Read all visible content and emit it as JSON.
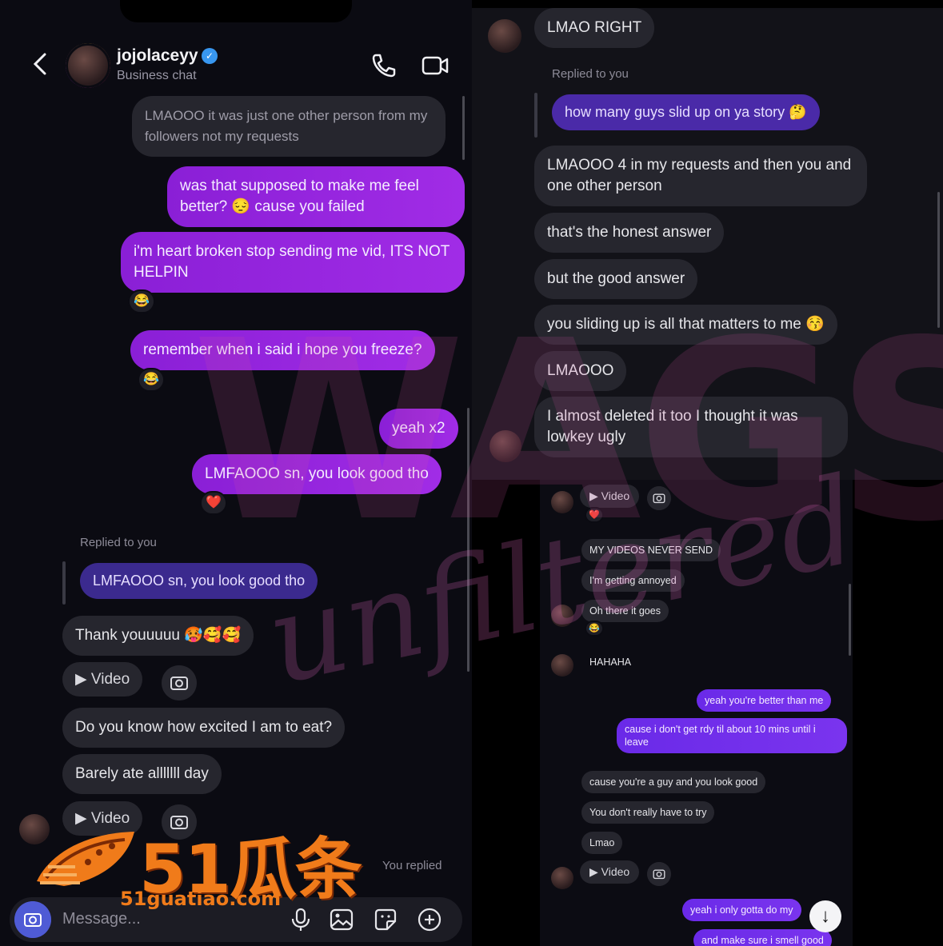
{
  "header": {
    "username": "jojolaceyy",
    "verified_mark": "✓",
    "subtitle": "Business chat",
    "back_icon": "chevron-left-icon",
    "call_icon": "phone-icon",
    "video_icon": "video-camera-icon"
  },
  "left_messages": {
    "m1": "LMAOOO it was just one other person from my followers not my requests",
    "m2": "was that supposed to make me feel better? 😔 cause you failed",
    "m3": "i'm heart broken stop sending me vid, ITS NOT HELPIN",
    "m3_react": "😂",
    "m4": "remember when i said i hope you freeze?",
    "m4_react": "😂",
    "m5": "yeah x2",
    "m6": "LMFAOOO sn, you look good tho",
    "m6_react": "❤️",
    "replied_label": "Replied to you",
    "replied_quote": "LMFAOOO sn, you look good tho",
    "m7": "Thank youuuuu 🥵🥰🥰",
    "video_label": "Video",
    "m8": "Do you know how excited I am to eat?",
    "m9": "Barely ate alllllll day",
    "video_label_2": "Video",
    "you_replied": "You replied"
  },
  "input": {
    "placeholder": "Message...",
    "icons": [
      "microphone-icon",
      "image-icon",
      "sticker-icon",
      "plus-circle-icon"
    ]
  },
  "right_top_messages": {
    "r1": "LMAO RIGHT",
    "replied_label": "Replied to you",
    "replied_quote": "how many guys slid up on ya story 🤔",
    "r2": "LMAOOO 4 in my requests and then you and one other person",
    "r3": "that's the honest answer",
    "r4": "but the good answer",
    "r5": "you sliding up is all that matters to me 😚",
    "r6": "LMAOOO",
    "r7": "I almost deleted it too I thought it was lowkey ugly"
  },
  "right_bottom_messages": {
    "video_label": "Video",
    "video_react": "❤️",
    "s1": "MY VIDEOS NEVER SEND",
    "s2": "I'm getting annoyed",
    "s3": "Oh there it goes",
    "s3_react": "😂",
    "s4": "HAHAHA",
    "s5": "yeah you're better than me",
    "s6": "cause i don't get rdy til about 10 mins until i leave",
    "s7": "cause you're a guy and you look good",
    "s8": "You don't really have to try",
    "s9": "Lmao",
    "video_label_2": "Video",
    "s10": "yeah i only gotta do my",
    "s11": "and make sure i smell good",
    "down_arrow": "↓"
  },
  "watermark": {
    "wags": "WAGS",
    "unfiltered": "unfiltered"
  },
  "logo": {
    "text": "51瓜条",
    "url": "51guatiao.com"
  },
  "colors": {
    "outgoing_bubble": "#9a27e2",
    "incoming_bubble": "#26262e",
    "reply_bubble": "#3b2a8e",
    "logo_orange": "#f07b1a",
    "verified_blue": "#3897f0"
  }
}
